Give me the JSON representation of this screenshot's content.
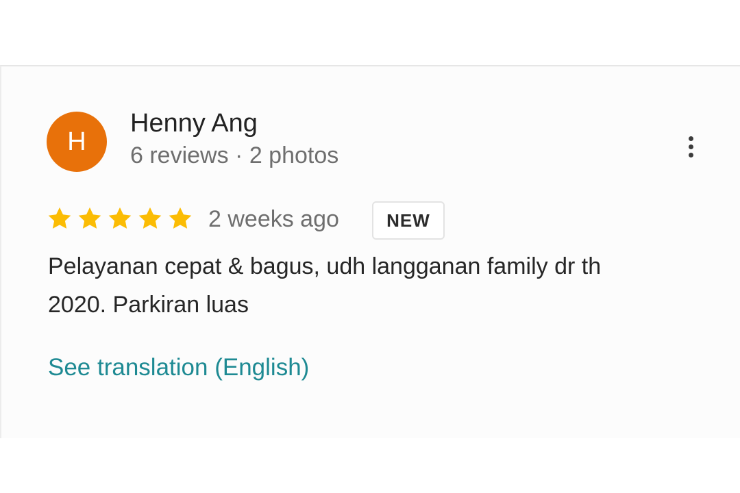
{
  "review": {
    "avatar": {
      "initial": "H",
      "color": "#e8710a"
    },
    "reviewer_name": "Henny Ang",
    "reviewer_meta": "6 reviews · 2 photos",
    "rating": 5,
    "rating_max": 5,
    "star_color": "#fbbc04",
    "date": "2 weeks ago",
    "badge": "NEW",
    "text": "Pelayanan cepat & bagus, udh langganan family dr th\n2020. Parkiran luas",
    "translate_link": "See translation (English)",
    "menu_icon": "more-vert-icon"
  }
}
